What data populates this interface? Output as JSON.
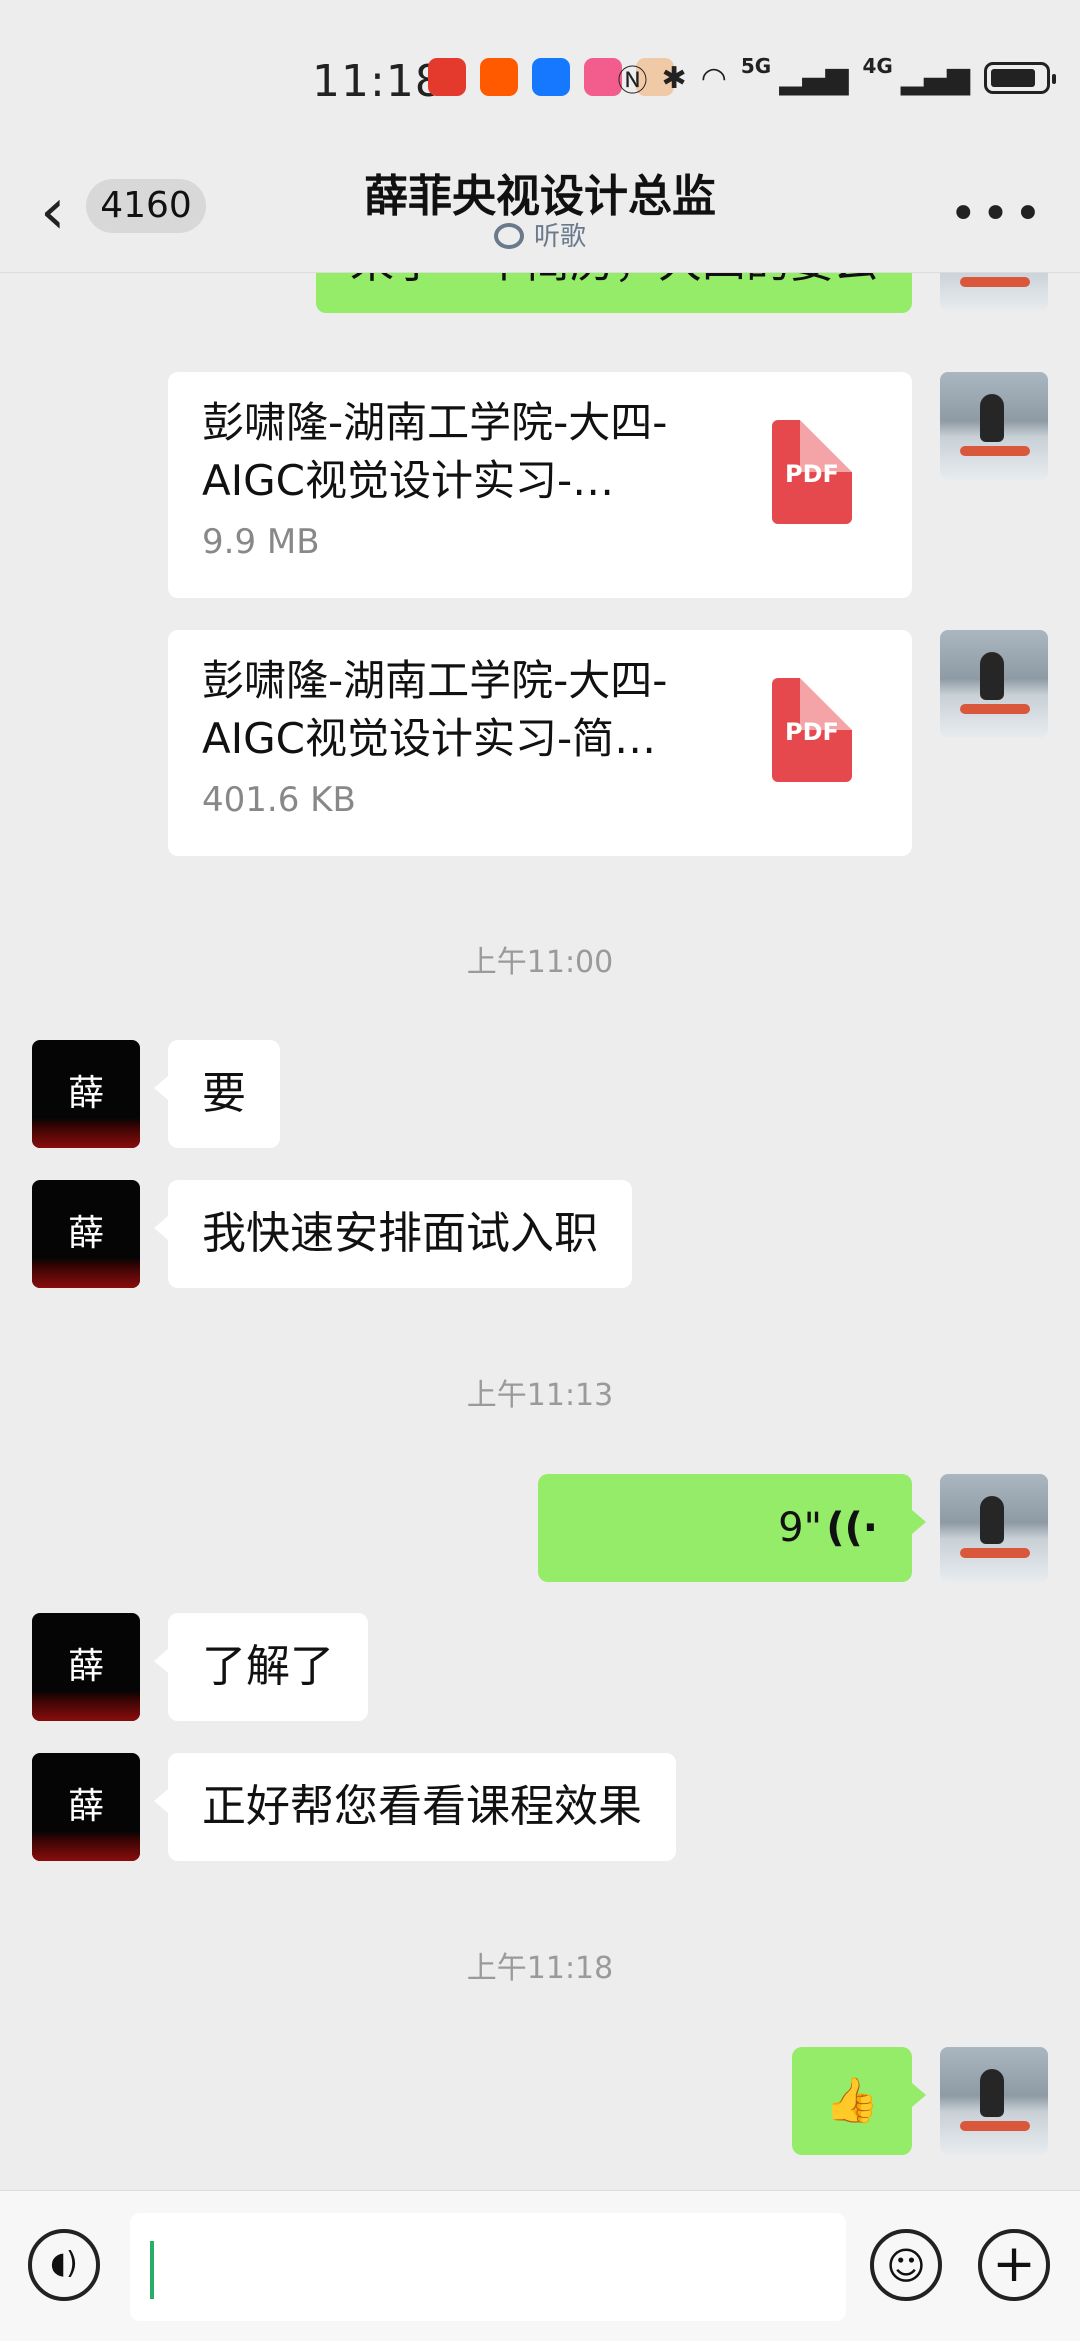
{
  "status_bar": {
    "time": "11:18",
    "network_5g": "5G",
    "network_4g": "4G"
  },
  "nav": {
    "back_badge": "4160",
    "title": "薛菲央视设计总监",
    "subtitle": "听歌"
  },
  "messages": {
    "m1_text": "来了一个简历，大四的要么",
    "file1": {
      "name": "彭啸隆-湖南工学院-大四-AIGC视觉设计实习-…",
      "size": "9.9 MB",
      "type": "PDF"
    },
    "file2": {
      "name": "彭啸隆-湖南工学院-大四-AIGC视觉设计实习-简…",
      "size": "401.6 KB",
      "type": "PDF"
    },
    "ts1": "上午11:00",
    "m2_text": "要",
    "m3_text": "我快速安排面试入职",
    "ts2": "上午11:13",
    "voice_duration": "9\"",
    "m4_text": "了解了",
    "m5_text": "正好帮您看看课程效果",
    "ts3": "上午11:18",
    "m6_emoji": "👍"
  },
  "avatar_other_glyph": "薛",
  "input": {
    "placeholder": ""
  },
  "colors": {
    "sent_bubble": "#95ec69",
    "received_bubble": "#ffffff",
    "background": "#ededed",
    "pdf_red": "#e5484d"
  }
}
